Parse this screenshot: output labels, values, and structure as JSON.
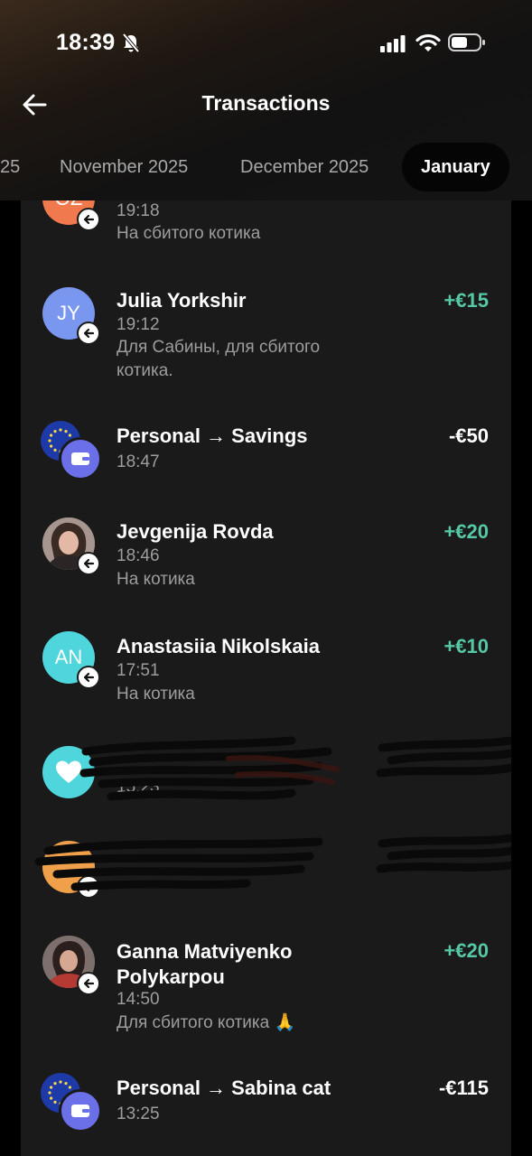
{
  "status_bar": {
    "time": "18:39"
  },
  "header": {
    "title": "Transactions",
    "tabs": [
      {
        "label": "25"
      },
      {
        "label": "November 2025"
      },
      {
        "label": "December 2025"
      },
      {
        "label": "January"
      }
    ]
  },
  "transactions": [
    {
      "initials": "OZ",
      "time": "19:18",
      "note": "На сбитого котика",
      "color": "#f07a4e"
    },
    {
      "initials": "JY",
      "name": "Julia Yorkshir",
      "time": "19:12",
      "note": "Для Сабины, для сбитого котика.",
      "amount": "+€15",
      "color": "#7a97f0"
    },
    {
      "name": "Personal → Savings",
      "time": "18:47",
      "amount": "-€50"
    },
    {
      "name": "Jevgenija Rovda",
      "time": "18:46",
      "note": "На котика",
      "amount": "+€20"
    },
    {
      "initials": "AN",
      "name": "Anastasiia Nikolskaia",
      "time": "17:51",
      "note": "На котика",
      "amount": "+€10",
      "color": "#4fd6dc"
    },
    {
      "time": "15:23",
      "color": "#4fd6dc"
    },
    {
      "color": "#f0a04a"
    },
    {
      "name": "Ganna Matviyenko Polykarpou",
      "time": "14:50",
      "note": "Для сбитого котика 🙏",
      "amount": "+€20"
    },
    {
      "name": "Personal → Sabina cat",
      "time": "13:25",
      "amount": "-€115"
    }
  ],
  "icons": {
    "back": "arrow-left-icon",
    "bell_off": "bell-slash-icon",
    "incoming": "arrow-left-circle-icon",
    "wallet": "wallet-icon",
    "eu": "eu-flag-icon",
    "heart": "heart-icon"
  },
  "colors": {
    "positive": "#55c8a6",
    "background": "#1a1a1a",
    "accent_wallet": "#6b6fe8"
  }
}
